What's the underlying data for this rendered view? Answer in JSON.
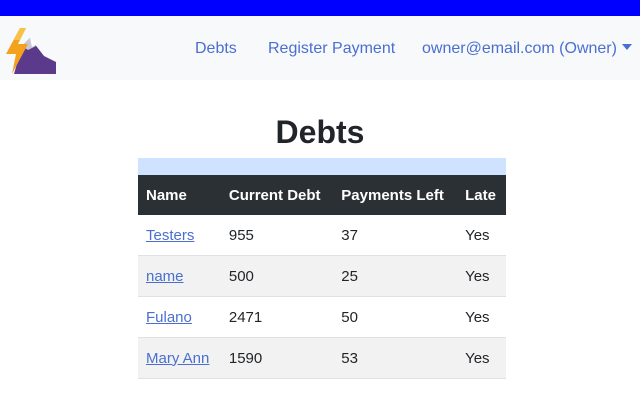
{
  "colors": {
    "top_bar": "#0000ff",
    "navbar_bg": "#f8f9fa",
    "link": "#4a6fd0",
    "table_header_bg": "#2b3035",
    "caption_strip": "#cfe2ff",
    "striped_row": "#f2f2f2"
  },
  "brand": {
    "icon": "lightning-mountain-logo"
  },
  "nav": {
    "debts": "Debts",
    "register_payment": "Register Payment",
    "user": "owner@email.com (Owner)",
    "user_icon": "chevron-down-icon"
  },
  "page": {
    "title": "Debts"
  },
  "table": {
    "headers": [
      "Name",
      "Current Debt",
      "Payments Left",
      "Late"
    ],
    "rows": [
      {
        "name": "Testers",
        "current_debt": "955",
        "payments_left": "37",
        "late": "Yes"
      },
      {
        "name": "name",
        "current_debt": "500",
        "payments_left": "25",
        "late": "Yes"
      },
      {
        "name": "Fulano",
        "current_debt": "2471",
        "payments_left": "50",
        "late": "Yes"
      },
      {
        "name": "Mary Ann",
        "current_debt": "1590",
        "payments_left": "53",
        "late": "Yes"
      }
    ]
  }
}
